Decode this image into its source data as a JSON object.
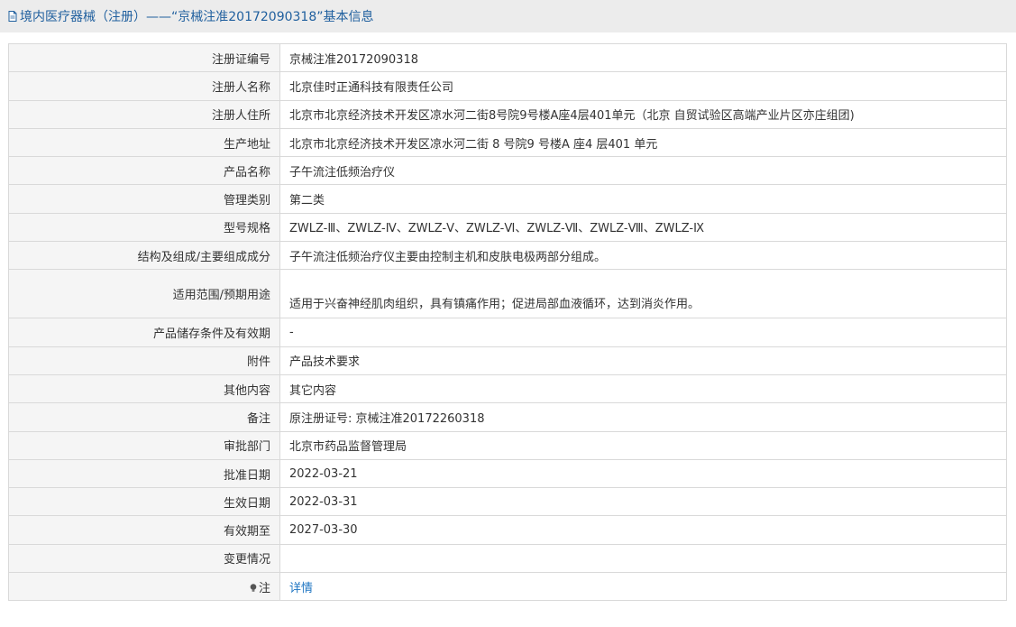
{
  "header": {
    "icon": "document-icon",
    "title": "境内医疗器械（注册）——“京械注准20172090318”基本信息"
  },
  "rows": [
    {
      "label": "注册证编号",
      "value": "京械注准20172090318"
    },
    {
      "label": "注册人名称",
      "value": "北京佳时正通科技有限责任公司"
    },
    {
      "label": "注册人住所",
      "value": "北京市北京经济技术开发区凉水河二街8号院9号楼A座4层401单元（北京 自贸试验区高端产业片区亦庄组团)"
    },
    {
      "label": "生产地址",
      "value": "北京市北京经济技术开发区凉水河二街 8 号院9 号楼A 座4 层401 单元"
    },
    {
      "label": "产品名称",
      "value": "子午流注低频治疗仪"
    },
    {
      "label": "管理类别",
      "value": "第二类"
    },
    {
      "label": "型号规格",
      "value": "ZWLZ-Ⅲ、ZWLZ-Ⅳ、ZWLZ-Ⅴ、ZWLZ-Ⅵ、ZWLZ-Ⅶ、ZWLZ-Ⅷ、ZWLZ-Ⅸ"
    },
    {
      "label": "结构及组成/主要组成成分",
      "value": "子午流注低频治疗仪主要由控制主机和皮肤电极两部分组成。"
    },
    {
      "label": "适用范围/预期用途",
      "value": "适用于兴奋神经肌肉组织，具有镇痛作用；促进局部血液循环，达到消炎作用。"
    },
    {
      "label": "产品储存条件及有效期",
      "value": "-"
    },
    {
      "label": "附件",
      "value": "产品技术要求"
    },
    {
      "label": "其他内容",
      "value": "其它内容"
    },
    {
      "label": "备注",
      "value": "原注册证号: 京械注准20172260318"
    },
    {
      "label": "审批部门",
      "value": "北京市药品监督管理局"
    },
    {
      "label": "批准日期",
      "value": "2022-03-21"
    },
    {
      "label": "生效日期",
      "value": "2022-03-31"
    },
    {
      "label": "有效期至",
      "value": "2027-03-30"
    },
    {
      "label": "变更情况",
      "value": ""
    }
  ],
  "note_row": {
    "icon": "lightbulb-icon",
    "label": "注",
    "link": "详情"
  }
}
